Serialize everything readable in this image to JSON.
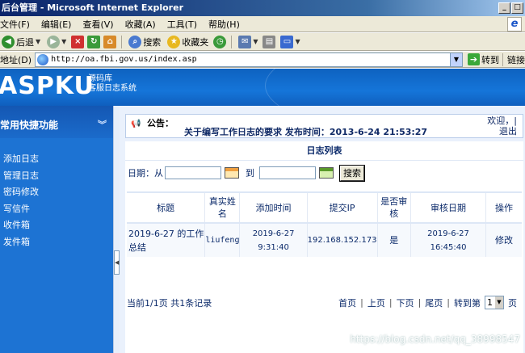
{
  "window": {
    "title": "后台管理 - Microsoft Internet Explorer",
    "buttons": {
      "minimize": "_",
      "maximize": "□",
      "close": "X"
    }
  },
  "menubar": {
    "items": [
      "文件(F)",
      "编辑(E)",
      "查看(V)",
      "收藏(A)",
      "工具(T)",
      "帮助(H)"
    ]
  },
  "toolbar": {
    "back_label": "后退",
    "search_label": "搜索",
    "favorites_label": "收藏夹"
  },
  "address": {
    "label": "地址(D)",
    "url": "http://oa.fbi.gov.us/index.asp",
    "go_label": "转到",
    "links_label": "链接"
  },
  "banner": {
    "logo": "ASPKU",
    "sub_line1": "源码库",
    "sub_line2": "客服日志系统"
  },
  "sidebar": {
    "heading": "常用快捷功能",
    "items": [
      "添加日志",
      "管理日志",
      "密码修改",
      "写信件",
      "收件箱",
      "发件箱"
    ]
  },
  "notice": {
    "label": "公告：",
    "message": "关于编写工作日志的要求 发布时间：2013-6-24 21:53:27",
    "welcome": "欢迎，|",
    "logout": "退出"
  },
  "log_panel": {
    "title": "日志列表",
    "date_label": "日期：从",
    "to_label": "到",
    "search_button": "搜索",
    "columns": [
      "标题",
      "真实姓名",
      "添加时间",
      "提交IP",
      "是否审核",
      "审核日期",
      "操作"
    ],
    "rows": [
      {
        "title": "2019-6-27 的工作总结",
        "name": "liufeng",
        "added": "2019-6-27 9:31:40",
        "ip": "192.168.152.173",
        "reviewed": "是",
        "review_date": "2019-6-27 16:45:40",
        "action": "修改"
      }
    ]
  },
  "pager": {
    "info": "当前1/1页 共1条记录",
    "first": "首页",
    "prev": "上页",
    "next": "下页",
    "last": "尾页",
    "goto": "转到第",
    "page_value": "1",
    "page_unit": "页"
  },
  "watermark": "https://blog.csdn.net/qq_38998547"
}
